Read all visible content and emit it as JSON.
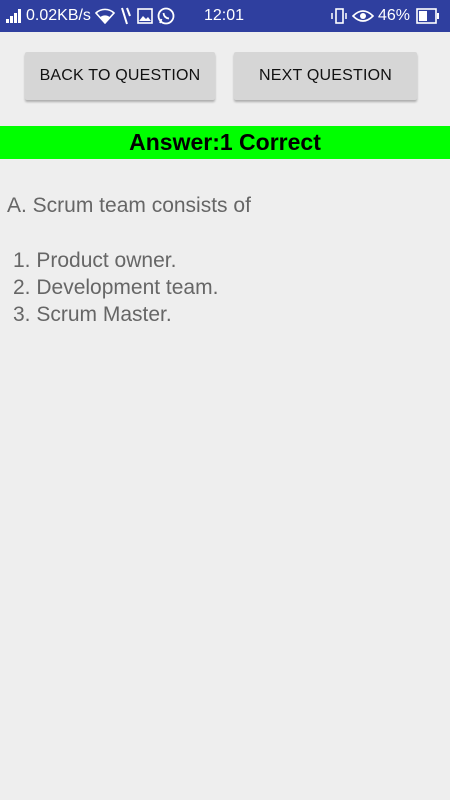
{
  "status_bar": {
    "network_speed": "0.02KB/s",
    "time": "12:01",
    "battery_percent": "46%",
    "icons": [
      "signal-bars-icon",
      "wifi-icon",
      "data-arrow-icon",
      "image-icon",
      "whatsapp-icon",
      "vibrate-icon",
      "eye-icon",
      "battery-icon"
    ]
  },
  "buttons": {
    "back_label": "BACK TO QUESTION",
    "next_label": "NEXT QUESTION"
  },
  "answer": {
    "banner_text": "Answer:1 Correct",
    "banner_color": "#00ff00"
  },
  "question": {
    "text": "A. Scrum team consists of",
    "options": [
      "1. Product owner.",
      "2. Development team.",
      "3. Scrum Master."
    ]
  },
  "colors": {
    "status_bar": "#2f3f9f",
    "background": "#eeeeee",
    "button": "#d6d6d6",
    "text_gray": "#666666"
  }
}
